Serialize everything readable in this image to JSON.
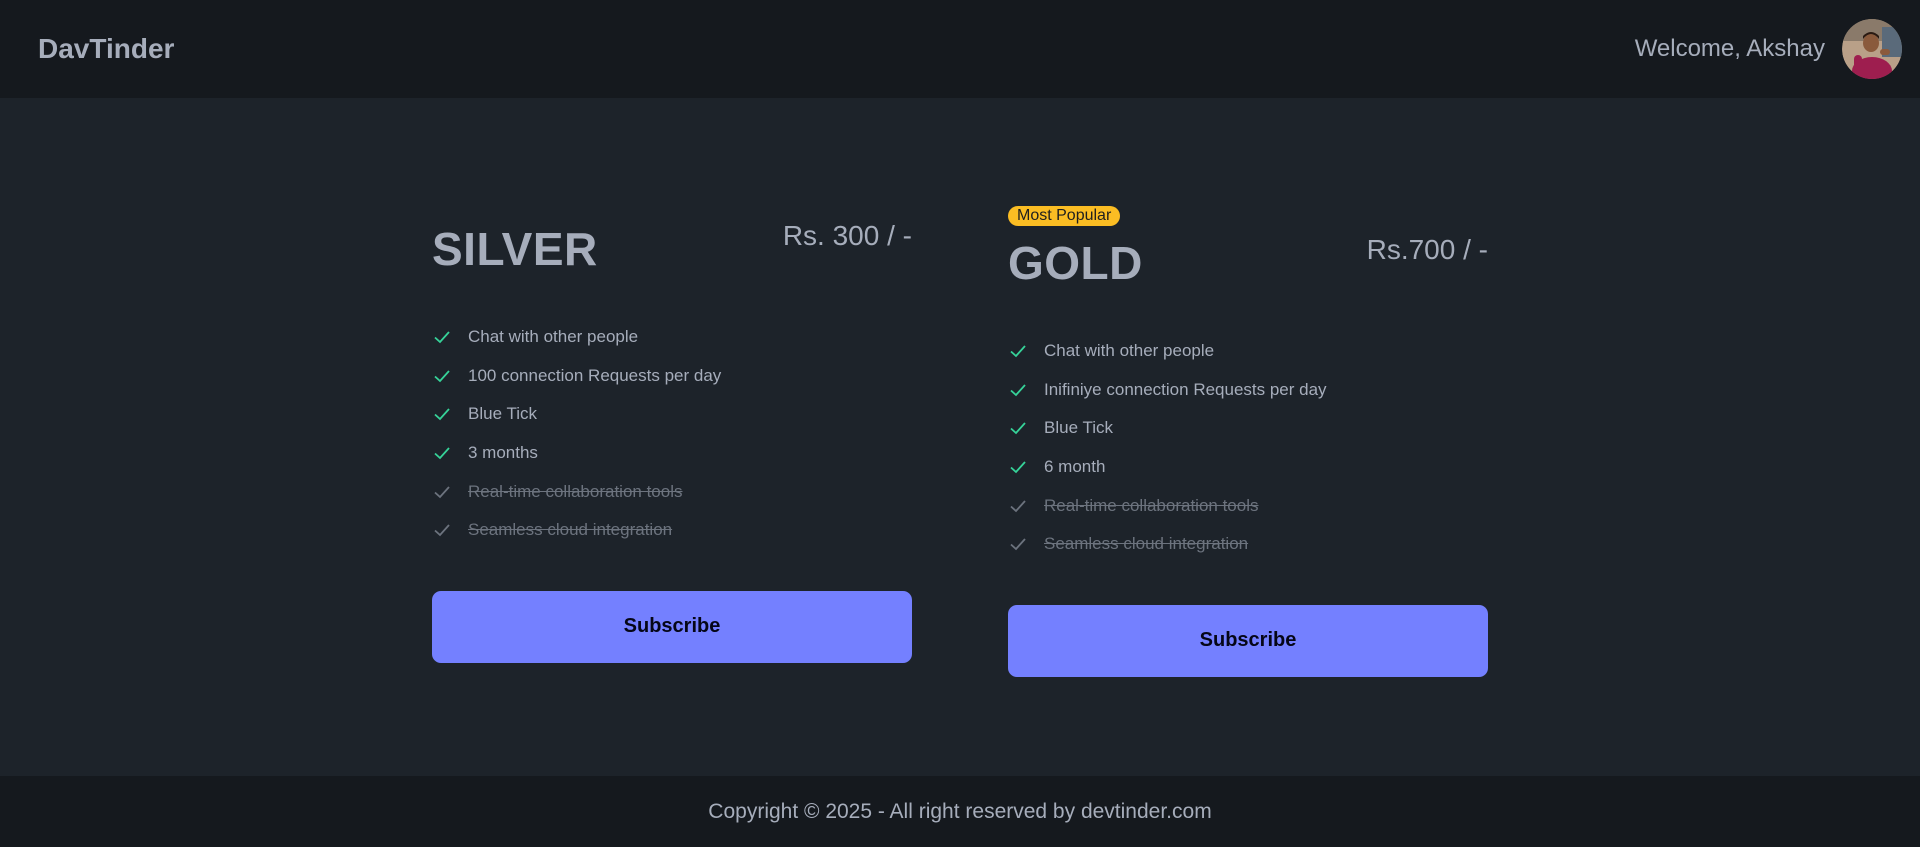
{
  "navbar": {
    "brand": "DavTinder",
    "welcome": "Welcome, Akshay",
    "avatar_icon": "user-avatar-photo"
  },
  "plans": [
    {
      "name": "SILVER",
      "price": "Rs. 300 / -",
      "badge": "",
      "features": [
        {
          "text": "Chat with other people",
          "included": true
        },
        {
          "text": "100 connection Requests per day",
          "included": true
        },
        {
          "text": "Blue Tick",
          "included": true
        },
        {
          "text": "3 months",
          "included": true
        },
        {
          "text": "Real-time collaboration tools",
          "included": false
        },
        {
          "text": "Seamless cloud integration",
          "included": false
        }
      ],
      "button": "Subscribe"
    },
    {
      "name": "GOLD",
      "price": "Rs.700 / -",
      "badge": "Most Popular",
      "features": [
        {
          "text": "Chat with other people",
          "included": true
        },
        {
          "text": "Inifiniye connection Requests per day",
          "included": true
        },
        {
          "text": "Blue Tick",
          "included": true
        },
        {
          "text": "6 month",
          "included": true
        },
        {
          "text": "Real-time collaboration tools",
          "included": false
        },
        {
          "text": "Seamless cloud integration",
          "included": false
        }
      ],
      "button": "Subscribe"
    }
  ],
  "footer": {
    "text": "Copyright © 2025 - All right reserved by devtinder.com"
  },
  "colors": {
    "page_bg": "#1d232a",
    "navbar_bg": "#15191e",
    "accent": "#7480ff",
    "badge": "#fbbd23",
    "check_included": "#36d399",
    "check_excluded": "#6c737e"
  }
}
